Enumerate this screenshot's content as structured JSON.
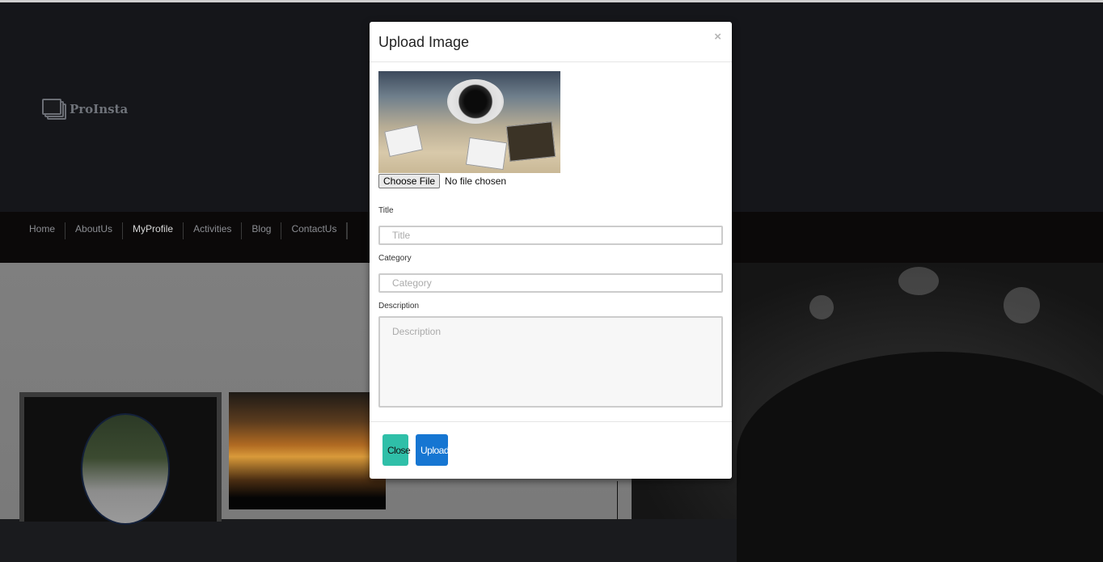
{
  "brand": {
    "logo_text": "ProInsta",
    "logo_icon": "stacked-photos-icon"
  },
  "nav": {
    "items": [
      {
        "label": "Home"
      },
      {
        "label": "AboutUs"
      },
      {
        "label": "MyProfile"
      },
      {
        "label": "Activities"
      },
      {
        "label": "Blog"
      },
      {
        "label": "ContactUs"
      }
    ],
    "active": "MyProfile"
  },
  "modal": {
    "title": "Upload Image",
    "close_symbol": "×",
    "file": {
      "button_label": "Choose File",
      "status": "No file chosen"
    },
    "fields": {
      "title": {
        "label": "Title",
        "placeholder": "Title",
        "value": ""
      },
      "category": {
        "label": "Category",
        "placeholder": "Category",
        "value": ""
      },
      "description": {
        "label": "Description",
        "placeholder": "Description",
        "value": ""
      }
    },
    "buttons": {
      "close": "Close",
      "upload": "Upload"
    }
  },
  "colors": {
    "close_button": "#2fbfa8",
    "upload_button": "#1676d2",
    "header_bg": "#15161a",
    "nav_bg": "#0b0909"
  }
}
